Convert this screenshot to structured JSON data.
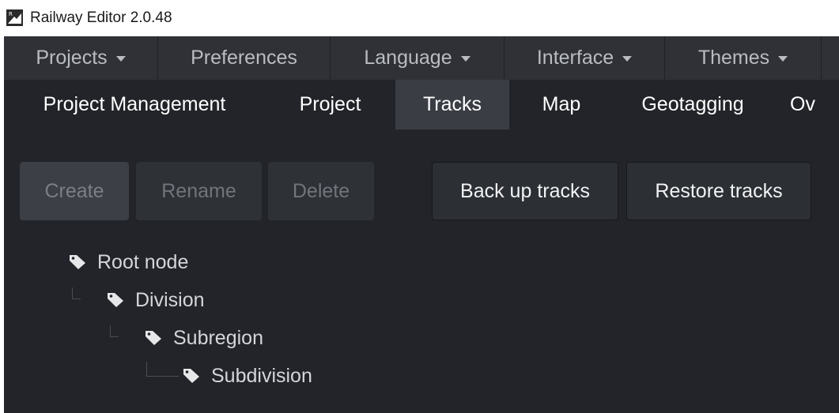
{
  "window": {
    "title": "Railway Editor 2.0.48"
  },
  "menubar": {
    "items": [
      {
        "label": "Projects",
        "dropdown": true
      },
      {
        "label": "Preferences",
        "dropdown": false
      },
      {
        "label": "Language",
        "dropdown": true
      },
      {
        "label": "Interface",
        "dropdown": true
      },
      {
        "label": "Themes",
        "dropdown": true
      }
    ]
  },
  "tabs": {
    "items": [
      {
        "label": "Project Management",
        "active": false
      },
      {
        "label": "Project",
        "active": false
      },
      {
        "label": "Tracks",
        "active": true
      },
      {
        "label": "Map",
        "active": false
      },
      {
        "label": "Geotagging",
        "active": false
      },
      {
        "label": "Ov",
        "active": false
      }
    ]
  },
  "toolbar": {
    "create_label": "Create",
    "rename_label": "Rename",
    "delete_label": "Delete",
    "backup_label": "Back up tracks",
    "restore_label": "Restore tracks"
  },
  "tree": {
    "nodes": [
      {
        "label": "Root node",
        "icon": "tag-icon"
      },
      {
        "label": "Division",
        "icon": "tag-icon"
      },
      {
        "label": "Subregion",
        "icon": "tag-icon"
      },
      {
        "label": "Subdivision",
        "icon": "tag-icon"
      }
    ]
  },
  "colors": {
    "background": "#222429",
    "menubar": "#2f3136",
    "active_tab": "#3a3d44",
    "text": "#ffffff"
  }
}
